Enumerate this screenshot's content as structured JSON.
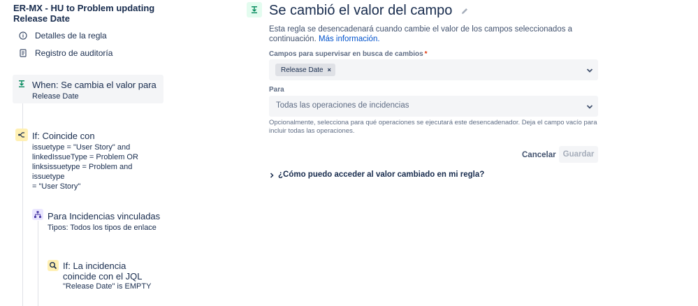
{
  "sidebar": {
    "rule_title": "ER-MX - HU to Problem updating Release Date",
    "nav": [
      {
        "label": "Detalles de la regla",
        "icon": "info-icon"
      },
      {
        "label": "Registro de auditoría",
        "icon": "audit-log-icon"
      }
    ],
    "trigger": {
      "title": "When: Se cambia el valor para",
      "subtitle": "Release Date",
      "icon": "field-changed-icon"
    },
    "condition": {
      "title": "If: Coincide con",
      "detail": "issuetype = \"User Story\" and\nlinkedIssueType = Problem OR\nlinksissuetype = Problem and issuetype\n= \"User Story\"",
      "icon": "branch-condition-icon"
    },
    "branch": {
      "title": "Para Incidencias vinculadas",
      "subtitle": "Tipos: Todos los tipos de enlace",
      "icon": "hierarchy-icon"
    },
    "jql": {
      "title": "If: La incidencia coincide con el JQL",
      "subtitle": "\"Release Date\" is EMPTY",
      "icon": "search-icon"
    }
  },
  "main": {
    "title": "Se cambió el valor del campo",
    "description": "Esta regla se desencadenará cuando cambie el valor de los campos seleccionados a continuación.",
    "more_link": "Más información.",
    "fields_label": "Campos para supervisar en busca de cambios",
    "required_mark": "*",
    "fields_tag": "Release Date",
    "tag_remove": "×",
    "para_label": "Para",
    "para_placeholder": "Todas las operaciones de incidencias",
    "helper": "Opcionalmente, selecciona para qué operaciones se ejecutará este desencadenador. Deja el campo vacío para incluir todas las operaciones.",
    "cancel_label": "Cancelar",
    "save_label": "Guardar",
    "faq": "¿Cómo puedo acceder al valor cambiado en mi regla?"
  },
  "colors": {
    "accent_link": "#0052cc",
    "trigger_green": "#00875a",
    "condition_yellow": "#fff0b3",
    "branch_purple": "#eae6ff"
  }
}
